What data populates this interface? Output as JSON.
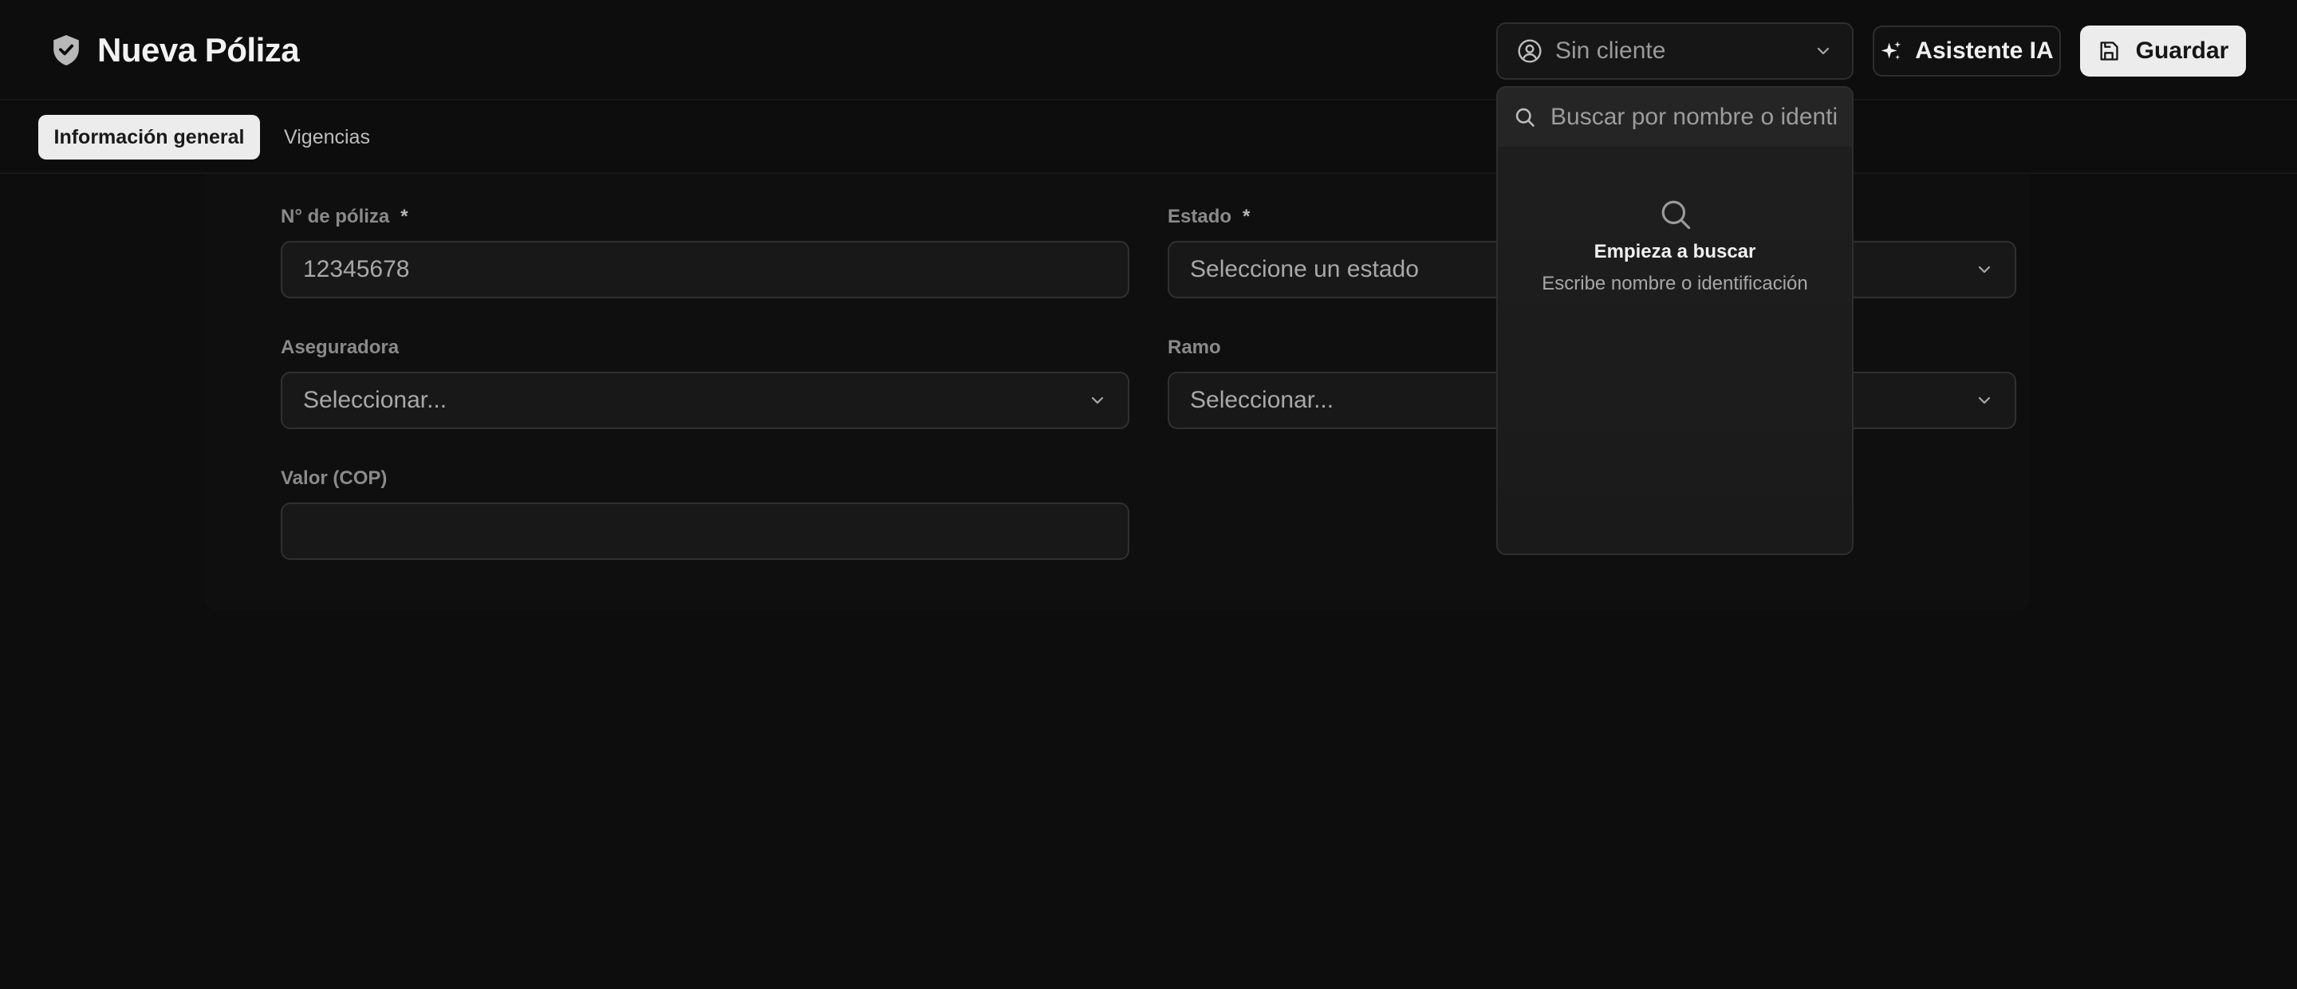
{
  "header": {
    "title": "Nueva Póliza",
    "logo_icon": "shield-icon",
    "client_select": {
      "value": "Sin cliente",
      "icon": "user-circle-icon"
    },
    "ai_button": {
      "label": "Asistente IA",
      "icon": "sparkles-icon"
    },
    "save_button": {
      "label": "Guardar",
      "icon": "save-icon"
    }
  },
  "tabs": [
    {
      "label": "Información general",
      "active": true
    },
    {
      "label": "Vigencias",
      "active": false
    }
  ],
  "form": {
    "policy_number": {
      "label": "N° de póliza",
      "required_mark": "*",
      "value": "12345678"
    },
    "status": {
      "label": "Estado",
      "required_mark": "*",
      "value": "Seleccione un estado"
    },
    "insurer": {
      "label": "Aseguradora",
      "value": "Seleccionar..."
    },
    "branch": {
      "label": "Ramo",
      "value": "Seleccionar..."
    },
    "amount": {
      "label": "Valor (COP)",
      "value": ""
    }
  },
  "client_dropdown": {
    "search_placeholder": "Buscar por nombre o identificación",
    "empty_title": "Empieza a buscar",
    "empty_subtitle": "Escribe nombre o identificación"
  },
  "colors": {
    "background": "#0d0d0d",
    "surface": "#181818",
    "border": "#303030",
    "primary_button": "#ececec"
  }
}
